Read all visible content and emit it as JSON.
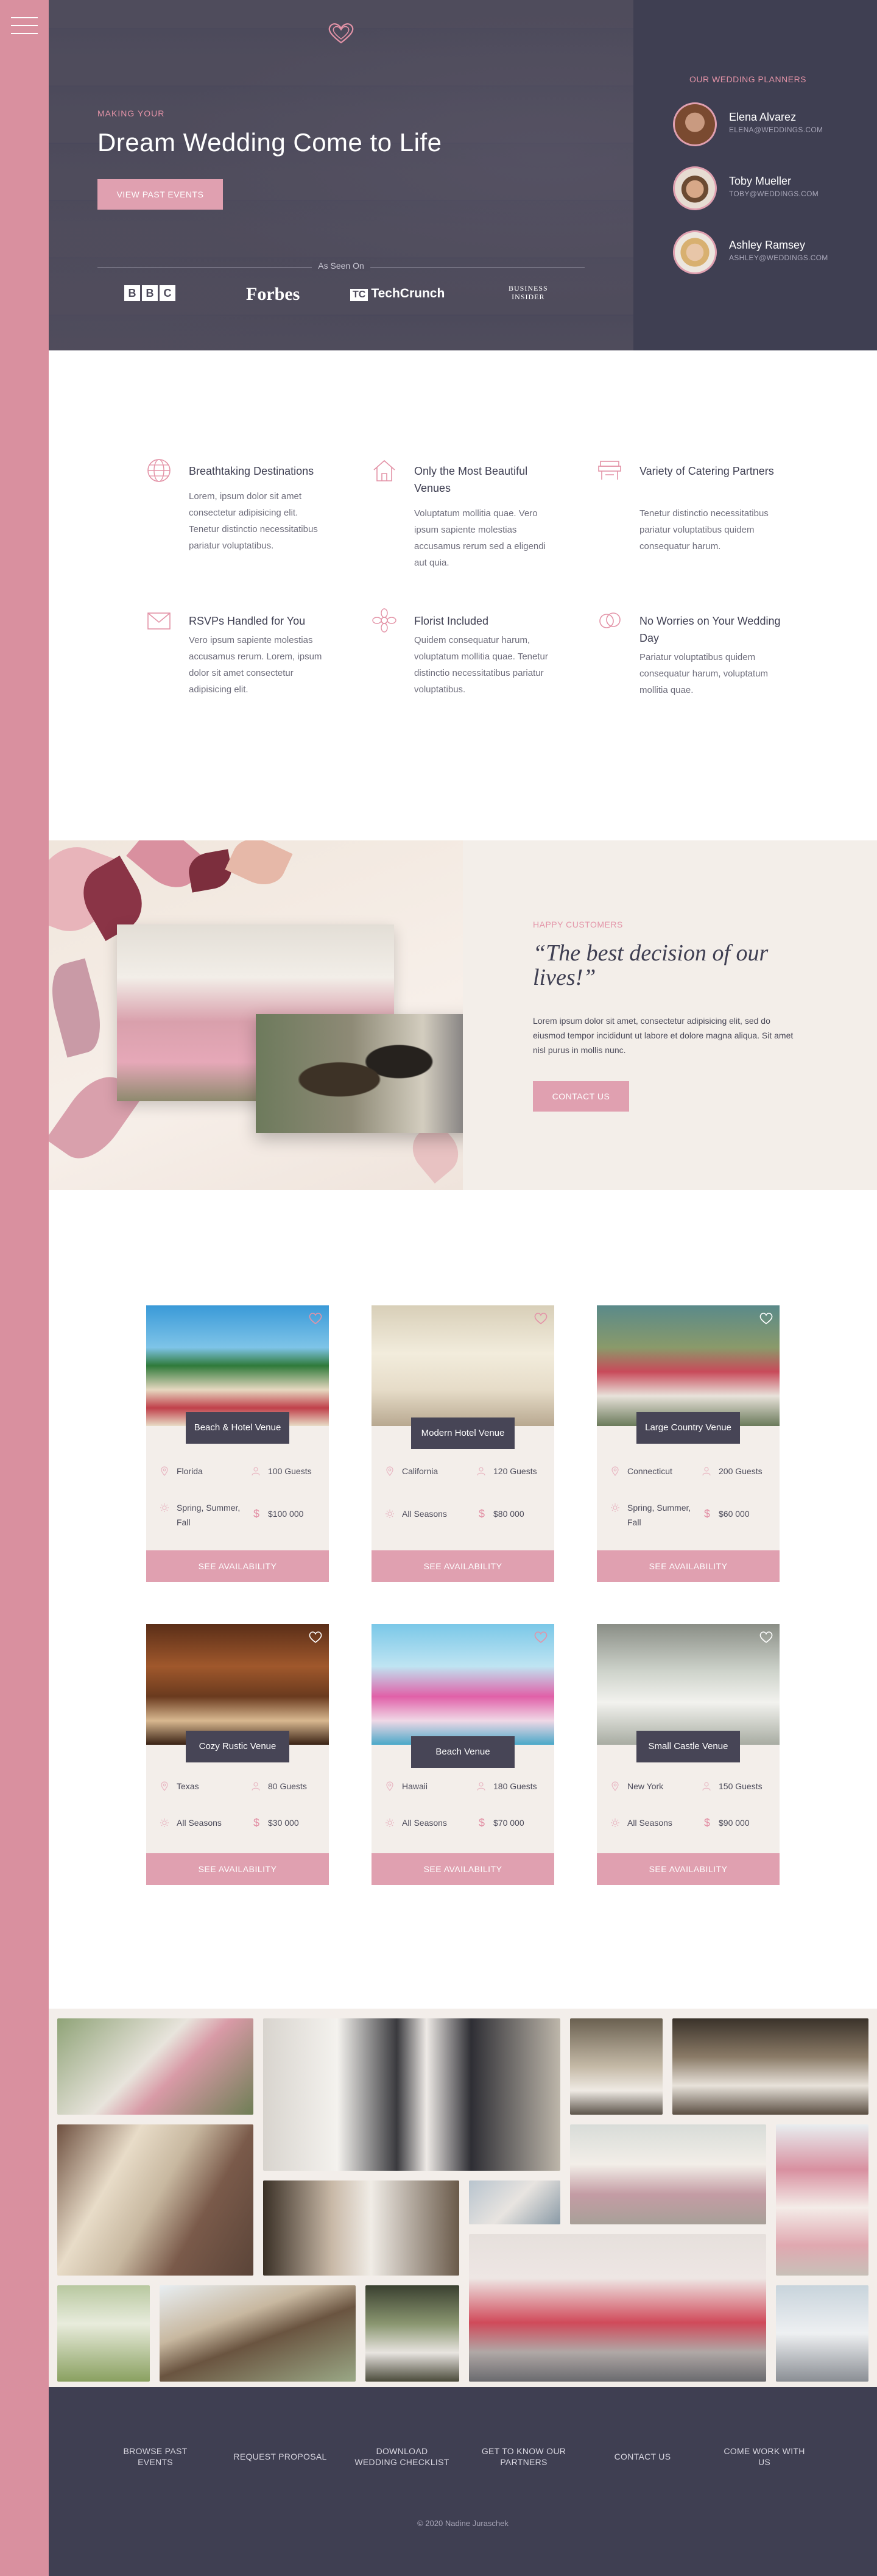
{
  "hero": {
    "kicker": "MAKING YOUR",
    "title": "Dream Wedding Come to Life",
    "button_label": "VIEW PAST EVENTS",
    "seen_label": "As Seen On",
    "brands": {
      "bbc": [
        "B",
        "B",
        "C"
      ],
      "forbes": "Forbes",
      "techcrunch": "TechCrunch",
      "tc_mark": "TC",
      "business_insider_line1": "BUSINESS",
      "business_insider_line2": "INSIDER"
    }
  },
  "planners": {
    "title": "OUR WEDDING PLANNERS",
    "items": [
      {
        "name": "Elena Alvarez",
        "email": "ELENA@WEDDINGS.COM"
      },
      {
        "name": "Toby Mueller",
        "email": "TOBY@WEDDINGS.COM"
      },
      {
        "name": "Ashley Ramsey",
        "email": "ASHLEY@WEDDINGS.COM"
      }
    ]
  },
  "features": [
    {
      "icon": "globe-icon",
      "title": "Breathtaking Destinations",
      "text": "Lorem, ipsum dolor sit amet consectetur adipisicing elit. Tenetur distinctio necessitatibus pariatur voluptatibus."
    },
    {
      "icon": "home-icon",
      "title": "Only the Most Beautiful Venues",
      "text": "Voluptatum mollitia quae. Vero ipsum sapiente molestias accusamus rerum sed a eligendi aut quia."
    },
    {
      "icon": "catering-icon",
      "title": "Variety of Catering Partners",
      "text": "Tenetur distinctio necessitatibus pariatur voluptatibus quidem consequatur harum."
    },
    {
      "icon": "envelope-icon",
      "title": "RSVPs Handled for You",
      "text": "Vero ipsum sapiente molestias accusamus rerum. Lorem, ipsum dolor sit amet consectetur adipisicing elit."
    },
    {
      "icon": "flower-icon",
      "title": "Florist Included",
      "text": "Quidem consequatur harum, voluptatum mollitia quae. Tenetur distinctio necessitatibus pariatur voluptatibus."
    },
    {
      "icon": "rings-icon",
      "title": "No Worries on Your Wedding Day",
      "text": "Pariatur voluptatibus quidem consequatur harum, voluptatum mollitia quae."
    }
  ],
  "testimonial": {
    "kicker": "HAPPY CUSTOMERS",
    "quote": "“The best decision of our lives!”",
    "text": "Lorem ipsum dolor sit amet, consectetur adipisicing elit, sed do eiusmod tempor incididunt ut labore et dolore magna aliqua. Sit amet nisl purus in mollis nunc.",
    "button_label": "CONTACT US"
  },
  "venues": {
    "button_label": "SEE AVAILABILITY",
    "items": [
      {
        "name": "Beach & Hotel Venue",
        "location": "Florida",
        "guests": "100 Guests",
        "season": "Spring, Summer, Fall",
        "price": "$100 000",
        "favorited": true
      },
      {
        "name": "Modern Hotel Venue",
        "location": "California",
        "guests": "120 Guests",
        "season": "All Seasons",
        "price": "$80 000",
        "favorited": true
      },
      {
        "name": "Large Country Venue",
        "location": "Connecticut",
        "guests": "200 Guests",
        "season": "Spring, Summer, Fall",
        "price": "$60 000",
        "favorited": false
      },
      {
        "name": "Cozy Rustic Venue",
        "location": "Texas",
        "guests": "80 Guests",
        "season": "All Seasons",
        "price": "$30 000",
        "favorited": false
      },
      {
        "name": "Beach Venue",
        "location": "Hawaii",
        "guests": "180 Guests",
        "season": "All Seasons",
        "price": "$70 000",
        "favorited": true
      },
      {
        "name": "Small Castle Venue",
        "location": "New York",
        "guests": "150 Guests",
        "season": "All Seasons",
        "price": "$90 000",
        "favorited": false
      }
    ]
  },
  "footer": {
    "nav": [
      {
        "line1": "BROWSE PAST",
        "line2": "EVENTS"
      },
      {
        "line1": "REQUEST PROPOSAL",
        "line2": ""
      },
      {
        "line1": "DOWNLOAD",
        "line2": "WEDDING CHECKLIST"
      },
      {
        "line1": "GET TO KNOW OUR",
        "line2": "PARTNERS"
      },
      {
        "line1": "CONTACT US",
        "line2": ""
      },
      {
        "line1": "COME WORK WITH",
        "line2": "US"
      }
    ],
    "copyright": "© 2020 Nadine Juraschek"
  },
  "colors": {
    "accent_pink": "#e0a0b0",
    "dark": "#3f3f52",
    "cream": "#f3eeea"
  }
}
